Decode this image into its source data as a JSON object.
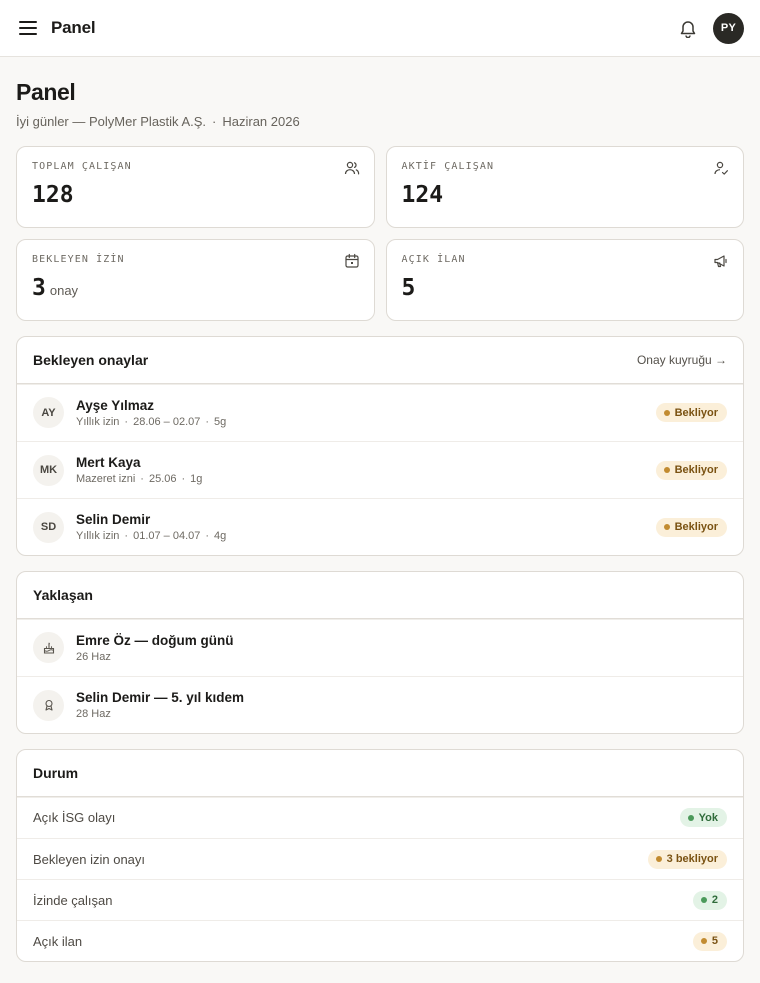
{
  "header": {
    "title": "Panel",
    "avatar": "PY",
    "menu_icon": "menu-icon",
    "bell_icon": "bell-icon"
  },
  "page": {
    "title": "Panel",
    "greeting": "İyi günler — PolyMer Plastik A.Ş.",
    "separator": "·",
    "period": "Haziran 2026"
  },
  "stats": [
    {
      "label": "TOPLAM ÇALIŞAN",
      "value": "128",
      "unit": "",
      "icon": "users-icon"
    },
    {
      "label": "AKTİF ÇALIŞAN",
      "value": "124",
      "unit": "",
      "icon": "user-check-icon"
    },
    {
      "label": "BEKLEYEN İZİN",
      "value": "3",
      "unit": "onay",
      "icon": "calendar-icon"
    },
    {
      "label": "AÇIK İLAN",
      "value": "5",
      "unit": "",
      "icon": "megaphone-icon"
    }
  ],
  "approvals": {
    "title": "Bekleyen onaylar",
    "link": "Onay kuyruğu →",
    "items": [
      {
        "initials": "AY",
        "name": "Ayşe Yılmaz",
        "type": "Yıllık izin",
        "dates": "28.06 – 02.07",
        "days": "5g",
        "status": "Bekliyor"
      },
      {
        "initials": "MK",
        "name": "Mert Kaya",
        "type": "Mazeret izni",
        "dates": "25.06",
        "days": "1g",
        "status": "Bekliyor"
      },
      {
        "initials": "SD",
        "name": "Selin Demir",
        "type": "Yıllık izin",
        "dates": "01.07 – 04.07",
        "days": "4g",
        "status": "Bekliyor"
      }
    ],
    "meta_sep": "·"
  },
  "upcoming": {
    "title": "Yaklaşan",
    "items": [
      {
        "icon": "cake-icon",
        "title": "Emre Öz — doğum günü",
        "date": "26 Haz"
      },
      {
        "icon": "award-icon",
        "title": "Selin Demir — 5. yıl kıdem",
        "date": "28 Haz"
      }
    ]
  },
  "status": {
    "title": "Durum",
    "items": [
      {
        "label": "Açık İSG olayı",
        "value": "Yok",
        "tone": "ok"
      },
      {
        "label": "Bekleyen izin onayı",
        "value": "3 bekliyor",
        "tone": "warn"
      },
      {
        "label": "İzinde çalışan",
        "value": "2",
        "tone": "ok"
      },
      {
        "label": "Açık ilan",
        "value": "5",
        "tone": "warn"
      }
    ]
  },
  "colors": {
    "warn_bg": "#fbefd9",
    "warn_dot": "#c28b30",
    "ok_bg": "#e3f3e6",
    "ok_dot": "#4b9a5a",
    "avatar_bg": "#2a2925"
  }
}
